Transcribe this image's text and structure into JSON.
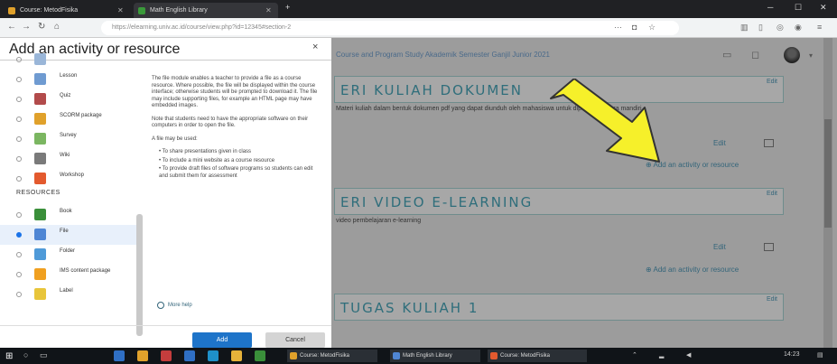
{
  "browser": {
    "tabs": [
      {
        "label": "Course: MetodFisika",
        "active": false
      },
      {
        "label": "Math English Library",
        "active": true
      }
    ],
    "new_tab": "+",
    "url": "https://elearning.univ.ac.id/course/view.php?id=12345#section-2"
  },
  "page": {
    "breadcrumb": "Course and Program Study  Akademik  Semester Ganjil  Junior 2021",
    "sections": [
      {
        "title": "ERI KULIAH DOKUMEN",
        "edit": "Edit",
        "subtitle": "Materi kuliah dalam bentuk dokumen pdf yang dapat diunduh oleh mahasiswa untuk dipelajari secara mandiri"
      },
      {
        "title": "ERI VIDEO E-LEARNING",
        "edit": "Edit",
        "subtitle": "video pembelajaran e-learning"
      },
      {
        "title": "TUGAS KULIAH 1",
        "edit": "Edit",
        "subtitle": ""
      }
    ],
    "edit_small": "Edit",
    "add_activity": "Add an activity or resource"
  },
  "modal": {
    "title": "Add an activity or resource",
    "close": "×",
    "activities": [
      {
        "label": "Lesson",
        "icon_color": "#6f9bd1"
      },
      {
        "label": "Quiz",
        "icon_color": "#b24b4b"
      },
      {
        "label": "SCORM package",
        "icon_color": "#e0a12b"
      },
      {
        "label": "Survey",
        "icon_color": "#7bb661"
      },
      {
        "label": "Wiki",
        "icon_color": "#7a7a7a"
      },
      {
        "label": "Workshop",
        "icon_color": "#e35a2e"
      }
    ],
    "resources_heading": "RESOURCES",
    "resources": [
      {
        "label": "Book",
        "icon_color": "#3a8f3a",
        "selected": false
      },
      {
        "label": "File",
        "icon_color": "#4f86d4",
        "selected": true
      },
      {
        "label": "Folder",
        "icon_color": "#4f9ad8",
        "selected": false
      },
      {
        "label": "IMS content package",
        "icon_color": "#f0a020",
        "selected": false
      },
      {
        "label": "Label",
        "icon_color": "#e8c53a",
        "selected": false
      }
    ],
    "help": {
      "p1": "The file module enables a teacher to provide a file as a course resource. Where possible, the file will be displayed within the course interface; otherwise students will be prompted to download it. The file may include supporting files, for example an HTML page may have embedded images.",
      "p2": "Note that students need to have the appropriate software on their computers in order to open the file.",
      "p3": "A file may be used:",
      "items": [
        "To share presentations given in class",
        "To include a mini website as a course resource",
        "To provide draft files of software programs so students can edit and submit them for assessment"
      ],
      "more": "More help"
    },
    "add_button": "Add",
    "cancel_button": "Cancel"
  },
  "taskbar": {
    "tasks": [
      {
        "label": "Course: MetodFisika",
        "color": "#e0a12b"
      },
      {
        "label": "Math English Library",
        "color": "#4f86d4"
      },
      {
        "label": "Course: MetodFisika",
        "color": "#e35a2e"
      }
    ],
    "time": "14:23"
  }
}
